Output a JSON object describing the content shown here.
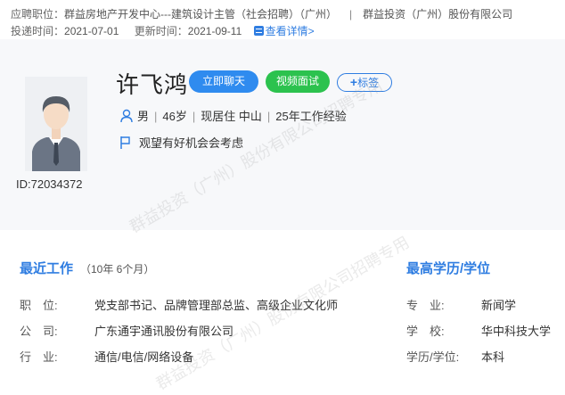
{
  "header": {
    "position_label": "应聘职位：",
    "position_value": "群益房地产开发中心---建筑设计主管（社会招聘）（广州）",
    "company": "群益投资（广州）股份有限公司",
    "delivery_label": "投递时间：",
    "delivery_value": "2021-07-01",
    "update_label": "更新时间：",
    "update_value": "2021-09-11",
    "detail_link": "查看详情>"
  },
  "profile": {
    "name": "许飞鸿",
    "chat_button": "立即聊天",
    "video_button": "视频面试",
    "tag_button": "标签",
    "id": "ID:72034372",
    "gender": "男",
    "age": "46岁",
    "residence": "现居住 中山",
    "experience": "25年工作经验",
    "job_status": "观望有好机会会考虑"
  },
  "recent_work": {
    "title": "最近工作",
    "duration": "（10年 6个月）",
    "position_label": "职　位:",
    "position_value": "党支部书记、品牌管理部总监、高级企业文化师",
    "company_label": "公　司:",
    "company_value": "广东通宇通讯股份有限公司",
    "industry_label": "行　业:",
    "industry_value": "通信/电信/网络设备"
  },
  "education": {
    "title": "最高学历/学位",
    "major_label": "专　业:",
    "major_value": "新闻学",
    "school_label": "学　校:",
    "school_value": "华中科技大学",
    "degree_label": "学历/学位:",
    "degree_value": "本科"
  },
  "watermarks": {
    "text1": "群益投资（广州）股份有限公司招聘专用",
    "text2": "群益投资（广州）股份有限公司招聘专用"
  },
  "colors": {
    "accent": "#2f7de1",
    "chat": "#2f8bef",
    "video": "#2cc24e"
  }
}
